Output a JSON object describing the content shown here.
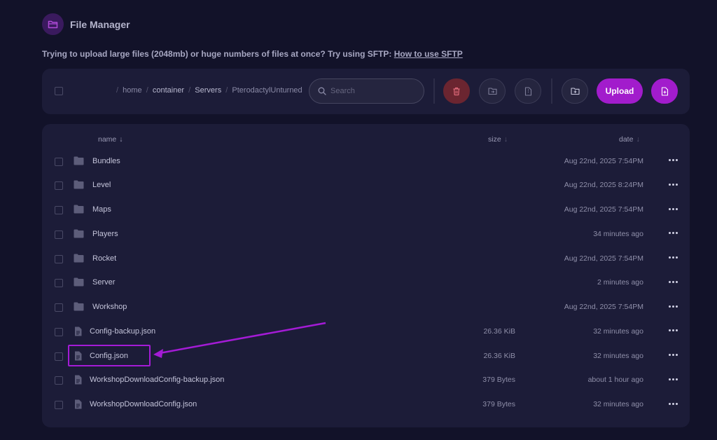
{
  "header": {
    "title": "File Manager"
  },
  "notice": {
    "text": "Trying to upload large files (2048mb) or huge numbers of files at once? Try using SFTP: ",
    "link": "How to use SFTP"
  },
  "toolbar": {
    "breadcrumb": [
      "home",
      "container",
      "Servers",
      "PterodactylUnturned"
    ],
    "search_placeholder": "Search",
    "upload_label": "Upload"
  },
  "table": {
    "columns": {
      "name": "name",
      "size": "size",
      "date": "date"
    },
    "sort_arrow": "↓",
    "rows": [
      {
        "type": "folder",
        "name": "Bundles",
        "size": "",
        "date": "Aug 22nd, 2025 7:54PM"
      },
      {
        "type": "folder",
        "name": "Level",
        "size": "",
        "date": "Aug 22nd, 2025 8:24PM"
      },
      {
        "type": "folder",
        "name": "Maps",
        "size": "",
        "date": "Aug 22nd, 2025 7:54PM"
      },
      {
        "type": "folder",
        "name": "Players",
        "size": "",
        "date": "34 minutes ago"
      },
      {
        "type": "folder",
        "name": "Rocket",
        "size": "",
        "date": "Aug 22nd, 2025 7:54PM"
      },
      {
        "type": "folder",
        "name": "Server",
        "size": "",
        "date": "2 minutes ago"
      },
      {
        "type": "folder",
        "name": "Workshop",
        "size": "",
        "date": "Aug 22nd, 2025 7:54PM"
      },
      {
        "type": "file",
        "name": "Config-backup.json",
        "size": "26.36 KiB",
        "date": "32 minutes ago"
      },
      {
        "type": "file",
        "name": "Config.json",
        "size": "26.36 KiB",
        "date": "32 minutes ago"
      },
      {
        "type": "file",
        "name": "WorkshopDownloadConfig-backup.json",
        "size": "379 Bytes",
        "date": "about 1 hour ago"
      },
      {
        "type": "file",
        "name": "WorkshopDownloadConfig.json",
        "size": "379 Bytes",
        "date": "32 minutes ago"
      }
    ]
  },
  "colors": {
    "background": "#121229",
    "card": "#1c1c38",
    "accent": "#a21ccc",
    "danger": "#6b2530"
  }
}
